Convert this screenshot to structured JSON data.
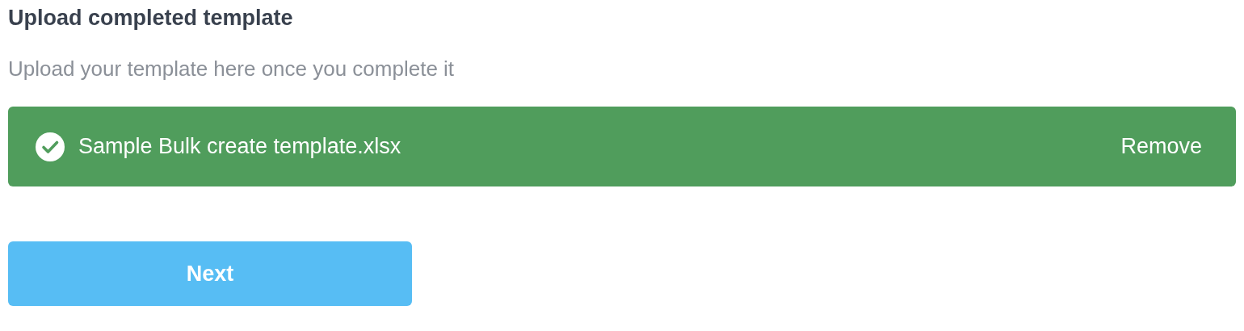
{
  "title": "Upload completed template",
  "subtitle": "Upload your template here once you complete it",
  "uploaded_file": {
    "name": "Sample Bulk create template.xlsx",
    "action": "Remove"
  },
  "buttons": [
    "Next"
  ]
}
